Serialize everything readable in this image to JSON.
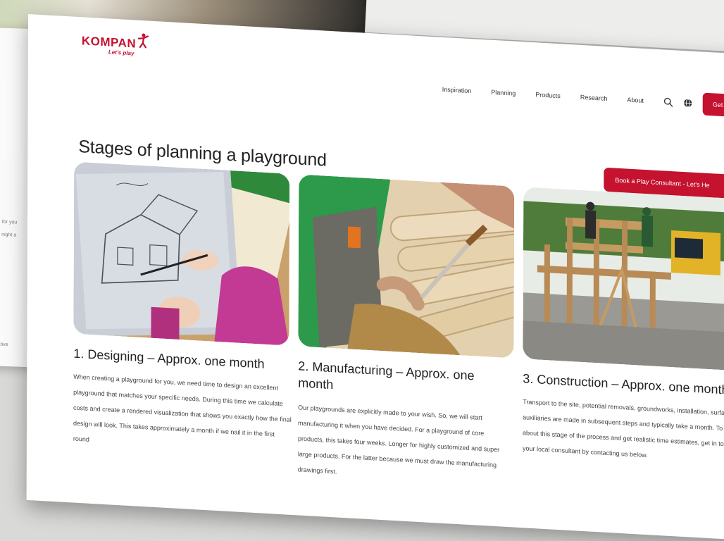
{
  "brand": {
    "name": "KOMPAN",
    "tagline": "Let's play"
  },
  "nav": {
    "items": [
      "Inspiration",
      "Planning",
      "Products",
      "Research",
      "About"
    ],
    "cta": "Get in t"
  },
  "section": {
    "title": "Stages of planning a playground",
    "book_button": "Book a Play Consultant - Let's He"
  },
  "stages": [
    {
      "title": "1. Designing – Approx. one month",
      "text": "When creating a playground for you, we need time to design an excellent playground that matches your specific needs. During this time we calculate costs and create a rendered visualization that shows you exactly how the final design will look. This takes approximately a month if we nail it in the first round"
    },
    {
      "title": "2. Manufacturing – Approx. one month",
      "text": "Our playgrounds are explicitly made to your wish. So, we will start manufacturing it when you have decided. For a playground of core products, this takes four weeks. Longer for highly customized and super large products. For the latter because we must draw the manufacturing drawings first."
    },
    {
      "title": "3. Construction – Approx. one month",
      "text": "Transport to the site, potential removals, groundworks, installation, surfacing, and auxiliaries are made in subsequent steps and typically take a month. To learn more about this stage of the process and get realistic time estimates, get in touch with your local consultant by contacting us below."
    }
  ],
  "background_fragments": [
    "for you",
    "night a",
    "ative"
  ],
  "colors": {
    "brand_red": "#c4122f",
    "text": "#222222",
    "page": "#ffffff"
  },
  "icons": [
    "search-icon",
    "globe-icon",
    "kompan-person-icon"
  ]
}
